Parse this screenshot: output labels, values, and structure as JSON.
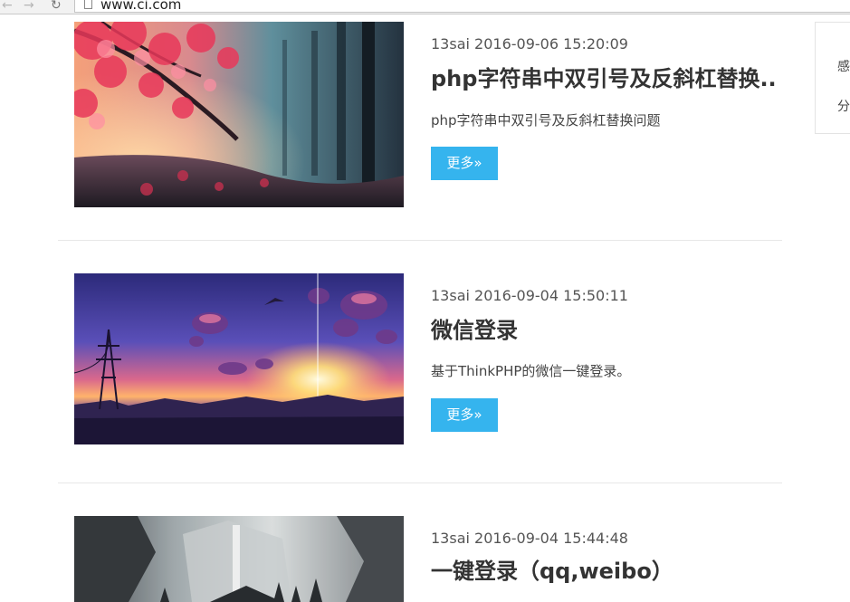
{
  "browser": {
    "url": "www.ci.com",
    "back_glyph": "←",
    "forward_glyph": "→",
    "reload_glyph": "↻"
  },
  "side_panel": {
    "items": [
      "感",
      "分"
    ]
  },
  "posts": [
    {
      "meta": "13sai 2016-09-06 15:20:09",
      "title": "php字符串中双引号及反斜杠替换..",
      "excerpt": "php字符串中双引号及反斜杠替换问题",
      "more_label": "更多»",
      "image": "pink-autumn-forest"
    },
    {
      "meta": "13sai 2016-09-04 15:50:11",
      "title": "微信登录",
      "excerpt": "基于ThinkPHP的微信一键登录。",
      "more_label": "更多»",
      "image": "purple-sunset-cityscape"
    },
    {
      "meta": "13sai 2016-09-04 15:44:48",
      "title": "一键登录（qq,weibo）",
      "image": "misty-mountain-waterfall"
    }
  ],
  "colors": {
    "accent": "#35b4ee",
    "title": "#333333",
    "divider": "#e8e8e8"
  }
}
